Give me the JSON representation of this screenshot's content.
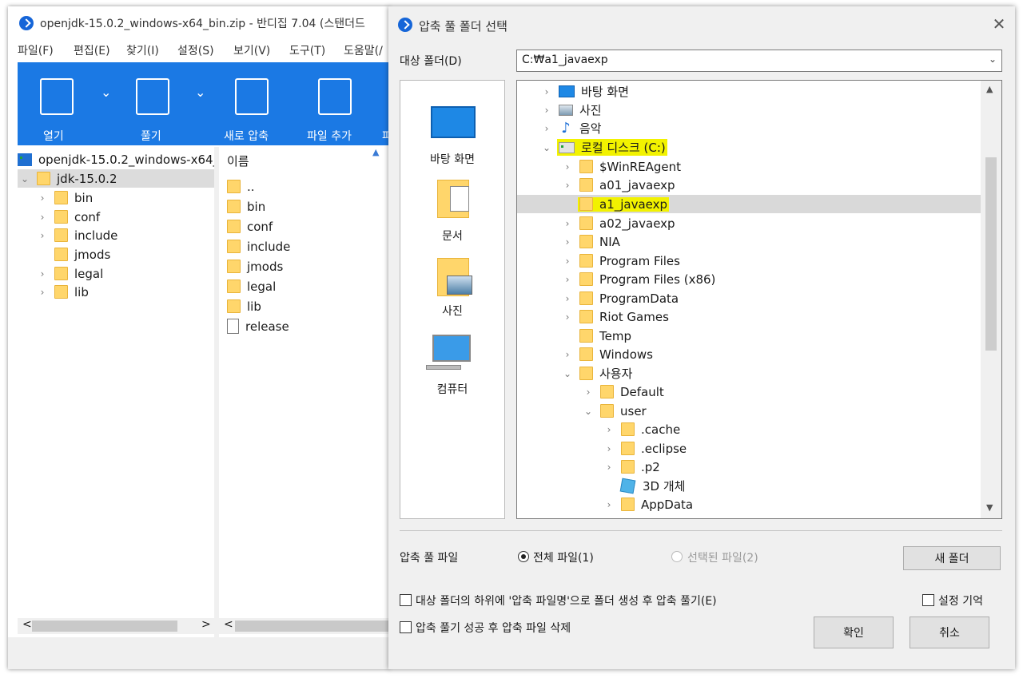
{
  "bandizip": {
    "title": "openjdk-15.0.2_windows-x64_bin.zip - 반디집 7.04 (스탠더드",
    "menu": [
      "파일(F)",
      "편집(E)",
      "찾기(I)",
      "설정(S)",
      "보기(V)",
      "도구(T)",
      "도움말(/"
    ],
    "toolbar": {
      "open": "열기",
      "extract": "풀기",
      "new_archive": "새로 압축",
      "add_file": "파일 추가",
      "more": "파"
    },
    "tree": {
      "root": "openjdk-15.0.2_windows-x64_b",
      "selected": "jdk-15.0.2",
      "children": [
        "bin",
        "conf",
        "include",
        "jmods",
        "legal",
        "lib"
      ]
    },
    "list": {
      "header": "이름",
      "items": [
        "..",
        "bin",
        "conf",
        "include",
        "jmods",
        "legal",
        "lib",
        "release"
      ]
    },
    "scroll_left": "<",
    "scroll_right": ">"
  },
  "dialog": {
    "title": "압축 풀 폴더 선택",
    "close": "✕",
    "dest_label": "대상 폴더(D)",
    "dest_value": "C:₩a1_javaexp",
    "places": [
      "바탕 화면",
      "문서",
      "사진",
      "컴퓨터"
    ],
    "tree": {
      "top": [
        "바탕 화면",
        "사진",
        "음악"
      ],
      "drive": "로컬 디스크 (C:)",
      "folders": [
        "$WinREAgent",
        "a01_javaexp",
        "a1_javaexp",
        "a02_javaexp",
        "NIA",
        "Program Files",
        "Program Files (x86)",
        "ProgramData",
        "Riot Games",
        "Temp",
        "Windows",
        "사용자"
      ],
      "users": [
        "Default",
        "user"
      ],
      "user_items": [
        ".cache",
        ".eclipse",
        ".p2",
        "3D 개체",
        "AppData"
      ]
    },
    "extract_label": "압축 풀 파일",
    "radio_all": "전체 파일(1)",
    "radio_selected": "선택된 파일(2)",
    "new_folder": "새 폴더",
    "opt_subfolder": "대상 폴더의 하위에 '압축 파일명'으로 폴더 생성 후 압축 풀기(E)",
    "opt_remember": "설정 기억",
    "opt_delete": "압축 풀기 성공 후 압축 파일 삭제",
    "ok": "확인",
    "cancel": "취소"
  }
}
